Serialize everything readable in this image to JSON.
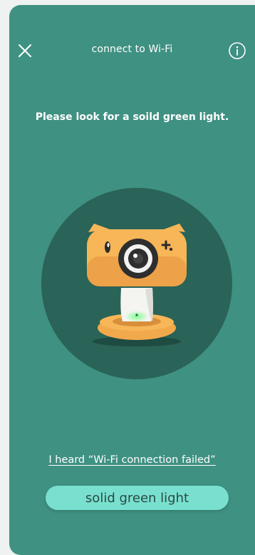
{
  "header": {
    "title": "connect to Wi-Fi",
    "close_icon": "close-icon",
    "info_icon": "info-icon"
  },
  "main": {
    "instruction": "Please look for a soild green light.",
    "illustration": "baby-camera-with-green-light",
    "help_link": "I heard “Wi-Fi connection failed”",
    "primary_button_label": "solid green light"
  },
  "colors": {
    "background": "#3f9182",
    "circle": "#2a6357",
    "button": "#79e0cf",
    "camera_orange": "#f2a94c",
    "status_light": "#5ff07a"
  }
}
